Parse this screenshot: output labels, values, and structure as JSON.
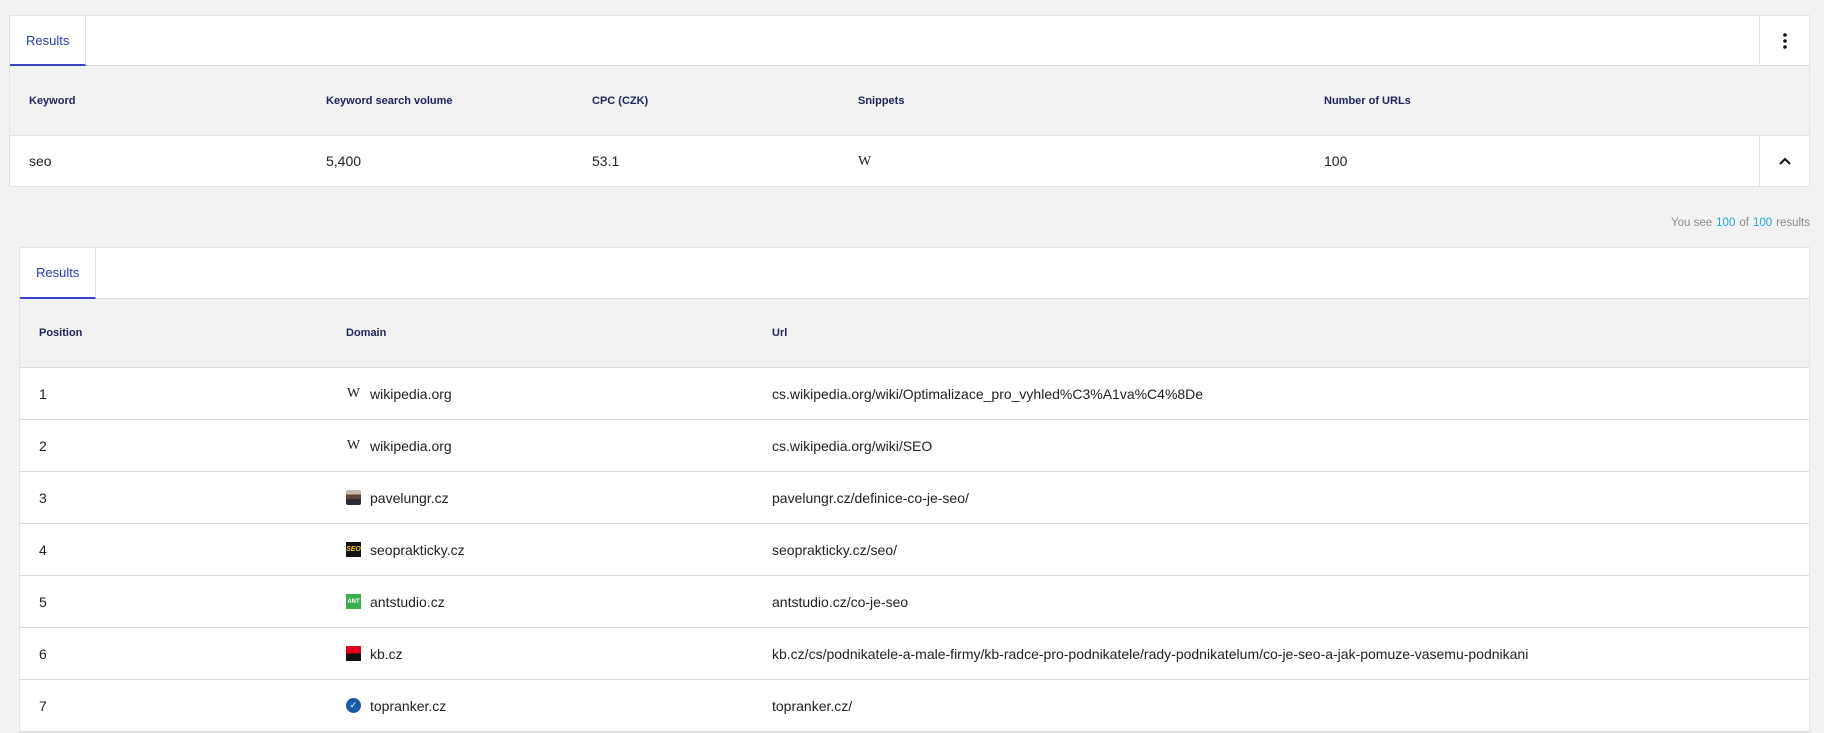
{
  "top_tabs": [
    {
      "label": "Results"
    }
  ],
  "keywords_table": {
    "headers": [
      "Keyword",
      "Keyword search volume",
      "CPC (CZK)",
      "Snippets",
      "Number of URLs"
    ],
    "row": {
      "keyword": "seo",
      "volume": "5,400",
      "cpc": "53.1",
      "snippet_icon": "W",
      "urls": "100"
    }
  },
  "summary": {
    "prefix": "You see",
    "shown": "100",
    "of": "of",
    "total": "100",
    "suffix": "results"
  },
  "inner_tabs": [
    {
      "label": "Results"
    }
  ],
  "results_table": {
    "headers": [
      "Position",
      "Domain",
      "Url"
    ],
    "rows": [
      {
        "position": "1",
        "domain": "wikipedia.org",
        "url": "cs.wikipedia.org/wiki/Optimalizace_pro_vyhled%C3%A1va%C4%8De",
        "favicon": "W"
      },
      {
        "position": "2",
        "domain": "wikipedia.org",
        "url": "cs.wikipedia.org/wiki/SEO",
        "favicon": "W"
      },
      {
        "position": "3",
        "domain": "pavelungr.cz",
        "url": "pavelungr.cz/definice-co-je-seo/",
        "favicon": ""
      },
      {
        "position": "4",
        "domain": "seoprakticky.cz",
        "url": "seoprakticky.cz/seo/",
        "favicon": "SEO"
      },
      {
        "position": "5",
        "domain": "antstudio.cz",
        "url": "antstudio.cz/co-je-seo",
        "favicon": "ANT"
      },
      {
        "position": "6",
        "domain": "kb.cz",
        "url": "kb.cz/cs/podnikatele-a-male-firmy/kb-radce-pro-podnikatele/rady-podnikatelum/co-je-seo-a-jak-pomuze-vasemu-podnikani",
        "favicon": ""
      },
      {
        "position": "7",
        "domain": "topranker.cz",
        "url": "topranker.cz/",
        "favicon": "✓"
      }
    ]
  },
  "colors": {
    "accent": "#3b44c4",
    "highlight": "#22a7d8",
    "header_text": "#1e2560"
  }
}
